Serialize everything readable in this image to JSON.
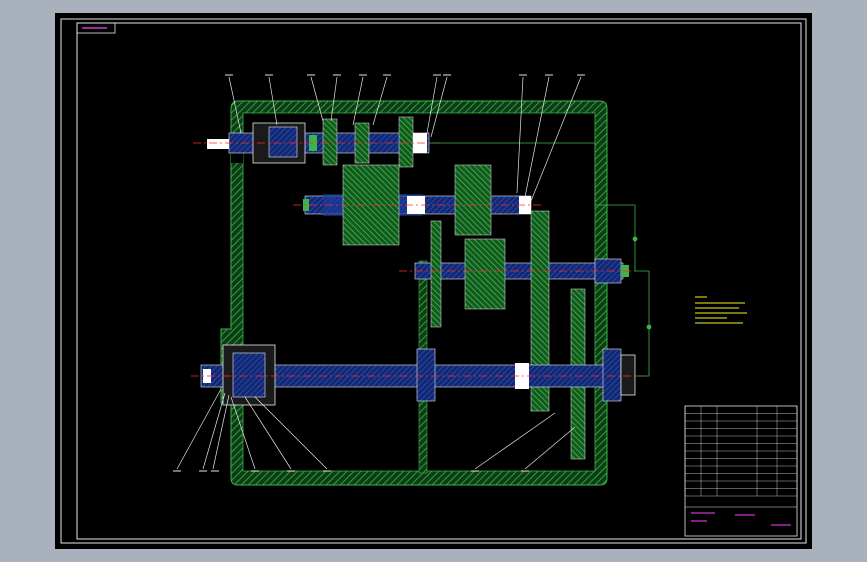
{
  "title_tag": "",
  "colors": {
    "background": "#000000",
    "outer_frame": "#a9b1bd",
    "housing_hatch": "#3cb44b",
    "shaft_blue": "#1e3ca0",
    "shaft_white": "#ffffff",
    "centerline_red": "#ff2a2a",
    "gear_fill": "#2e9e3e",
    "annotation_yellow": "#f5f51e",
    "leader_white": "#e6e6e6",
    "title_block_magenta": "#ff40ff"
  },
  "drawing": {
    "type": "gearbox-assembly-section",
    "shafts": 4,
    "part_balloons_top": [
      "1",
      "5",
      "4",
      "4",
      "5",
      "7",
      "8",
      "9",
      "10",
      "11",
      "12"
    ],
    "part_balloons_bottom": [
      "16",
      "15",
      "14",
      "13",
      "18",
      "17",
      "22",
      "20"
    ],
    "notes_block": {
      "visible": true
    }
  },
  "title_block": {
    "parts_list_rows": 12,
    "visible": true
  }
}
